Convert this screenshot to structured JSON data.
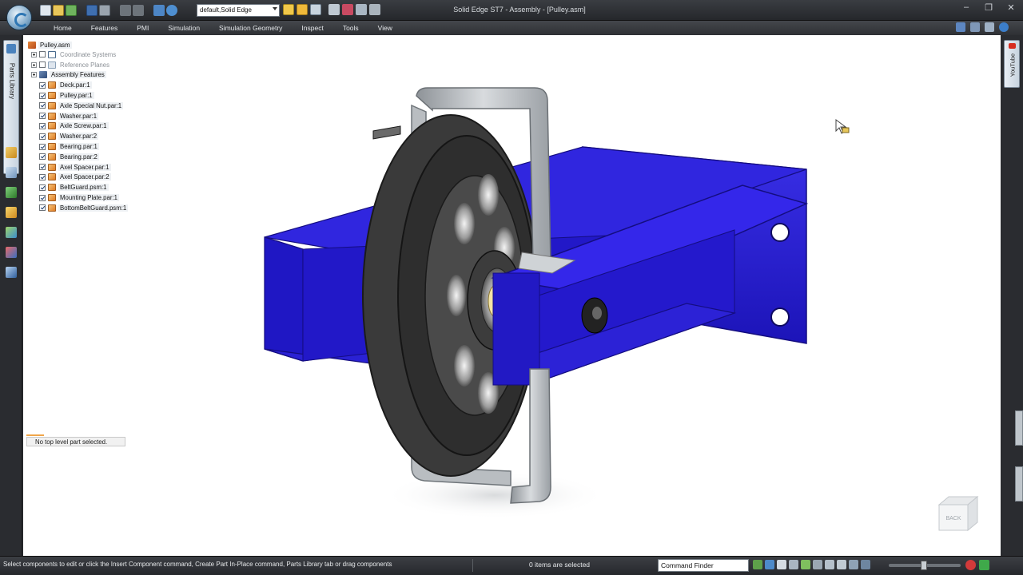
{
  "app": {
    "window_title": "Solid Edge ST7 - Assembly - [Pulley.asm]"
  },
  "quick_access": {
    "config_select": "default,Solid Edge"
  },
  "ribbon": {
    "tabs": [
      "Home",
      "Features",
      "PMI",
      "Simulation",
      "Simulation Geometry",
      "Inspect",
      "Tools",
      "View"
    ]
  },
  "left_dock": {
    "parts_library_label": "Parts Library"
  },
  "right_dock": {
    "youtube_label": "YouTube"
  },
  "pathfinder": {
    "root": "Pulley.asm",
    "groups": [
      {
        "label": "Coordinate Systems",
        "dim": true
      },
      {
        "label": "Reference Planes",
        "dim": true
      },
      {
        "label": "Assembly Features",
        "dim": false
      }
    ],
    "parts": [
      "Deck.par:1",
      "Pulley.par:1",
      "Axle Special Nut.par:1",
      "Washer.par:1",
      "Axle Screw.par:1",
      "Washer.par:2",
      "Bearing.par:1",
      "Bearing.par:2",
      "Axel Spacer.par:1",
      "Axel Spacer.par:2",
      "BeltGuard.psm:1",
      "Mounting Plate.par:1",
      "BottomBeltGuard.psm:1"
    ],
    "status": "No top level part selected."
  },
  "viewcube": {
    "face_label": "BACK"
  },
  "statusbar": {
    "prompt": "Select components to edit or click the Insert Component command, Create Part In-Place command, Parts Library tab or drag components",
    "selection_count": "0 items are selected",
    "command_finder": "Command Finder"
  },
  "colors": {
    "deck_blue": "#2a1fd6",
    "guard_gray": "#b8bcc0",
    "pulley_dark": "#3b3b3b",
    "axle_brass": "#e6d08a"
  }
}
